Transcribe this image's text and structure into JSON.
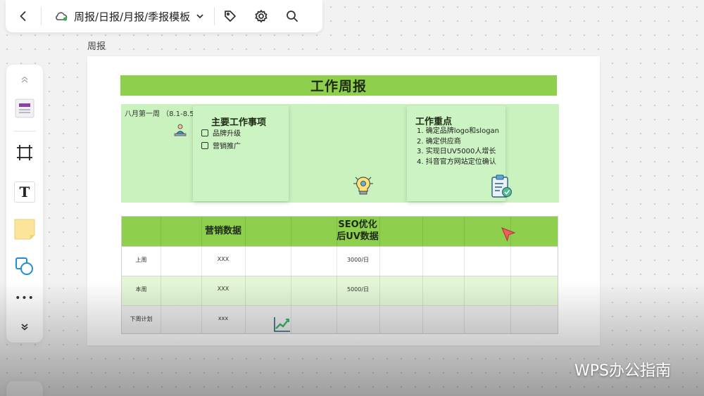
{
  "topbar": {
    "doc_title": "周报/日报/月报/季报模板",
    "icons": [
      "back-icon",
      "cloud-icon",
      "chevron-down-icon",
      "tag-icon",
      "gear-icon",
      "search-icon"
    ]
  },
  "board_label": "周报",
  "sidebar": {
    "tools": [
      "chevrons-up-icon",
      "template-icon",
      "frame-icon",
      "text-icon",
      "sticky-note-icon",
      "shapes-icon",
      "more-icon",
      "chevrons-down-icon"
    ],
    "text_tool_glyph": "T",
    "more_glyph": "•••"
  },
  "report": {
    "title": "工作周报",
    "week": "八月第一周 （8.1-8.5）",
    "main_tasks": {
      "title": "主要工作事项",
      "items": [
        "品牌升级",
        "营销推广"
      ]
    },
    "focus": {
      "title": "工作重点",
      "items": [
        "1.  确定品牌logo和slogan",
        "2.  确定供应商",
        "3.  实现日UV5000人增长",
        "4.  抖音官方网站定位确认"
      ]
    }
  },
  "table": {
    "headers": {
      "marketing": "营销数据",
      "seo_line1": "SEO优化",
      "seo_line2": "后UV数据"
    },
    "rows": [
      {
        "label": "上周",
        "marketing": "XXX",
        "seo": "3000/日"
      },
      {
        "label": "本周",
        "marketing": "XXX",
        "seo": "5000/日"
      },
      {
        "label": "下周计划",
        "marketing": "xxx",
        "seo": ""
      }
    ]
  },
  "watermark": "WPS办公指南",
  "colors": {
    "banner_green": "#8ed04d",
    "note_green": "#ccf3c2",
    "row_highlight": "#e3f7d6",
    "row_gray": "#ececec"
  }
}
